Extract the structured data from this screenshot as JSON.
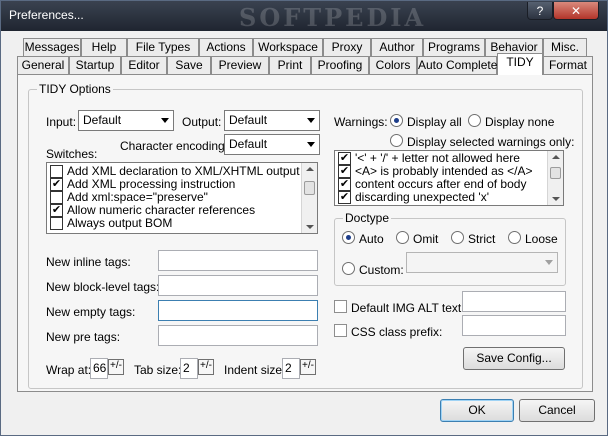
{
  "window": {
    "title": "Preferences...",
    "help_btn": "?",
    "close_btn": "✕",
    "watermark": "SOFTPEDIA"
  },
  "tabs_row1": [
    "Messages",
    "Help",
    "File Types",
    "Actions",
    "Workspace",
    "Proxy",
    "Author",
    "Programs",
    "Behavior",
    "Misc."
  ],
  "tabs_row2": [
    "General",
    "Startup",
    "Editor",
    "Save",
    "Preview",
    "Print",
    "Proofing",
    "Colors",
    "Auto Complete",
    "TIDY",
    "Format"
  ],
  "tidy": {
    "group_title": "TIDY Options",
    "input_label": "Input:",
    "input_value": "Default",
    "output_label": "Output:",
    "output_value": "Default",
    "char_enc_label": "Character encoding:",
    "char_enc_value": "Default",
    "switches_label": "Switches:",
    "switches": [
      {
        "label": "Add XML declaration to XML/XHTML output",
        "checked": false
      },
      {
        "label": "Add XML processing instruction",
        "checked": true
      },
      {
        "label": "Add xml:space=\"preserve\"",
        "checked": false
      },
      {
        "label": "Allow numeric character references",
        "checked": true
      },
      {
        "label": "Always output BOM",
        "checked": false
      }
    ],
    "new_inline_label": "New inline tags:",
    "new_block_label": "New block-level tags:",
    "new_empty_label": "New empty tags:",
    "new_pre_label": "New pre tags:",
    "wrap_label": "Wrap at:",
    "wrap_value": "66",
    "tab_label": "Tab size:",
    "tab_value": "2",
    "indent_label": "Indent size:",
    "indent_value": "2",
    "warnings_label": "Warnings:",
    "warn_display_all": "Display all",
    "warn_display_none": "Display none",
    "warn_display_selected": "Display selected warnings only:",
    "warnings": [
      {
        "label": "'<' + '/' + letter not allowed here",
        "checked": true
      },
      {
        "label": "<A> is probably intended as </A>",
        "checked": true
      },
      {
        "label": "content occurs after end of body",
        "checked": true
      },
      {
        "label": "discarding unexpected 'x'",
        "checked": true
      }
    ],
    "doctype_title": "Doctype",
    "doctype_auto": "Auto",
    "doctype_omit": "Omit",
    "doctype_strict": "Strict",
    "doctype_loose": "Loose",
    "doctype_custom": "Custom:",
    "default_img_alt": "Default IMG ALT text:",
    "css_prefix": "CSS class prefix:",
    "save_config": "Save Config..."
  },
  "footer": {
    "ok": "OK",
    "cancel": "Cancel"
  }
}
